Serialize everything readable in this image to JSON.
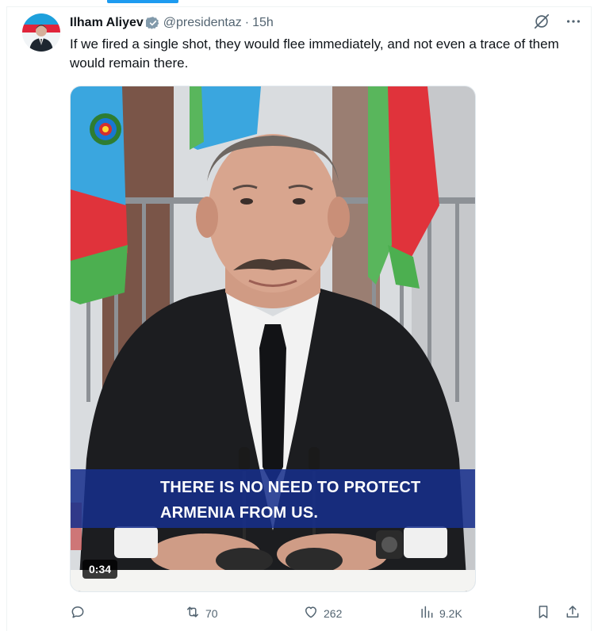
{
  "tweet": {
    "author_name": "Ilham Aliyev",
    "handle": "@presidentaz",
    "separator": "·",
    "time": "15h",
    "text": "If we fired a single shot, they would flee immediately, and not even a trace of them would remain there."
  },
  "media": {
    "caption_line1": "THERE IS NO NEED TO PROTECT",
    "caption_line2": "ARMENIA FROM US.",
    "duration": "0:34"
  },
  "actions": {
    "retweets": "70",
    "likes": "262",
    "views": "9.2K"
  },
  "colors": {
    "accent": "#1d9bf0",
    "secondary_text": "#536471",
    "caption_bg": "#162e8c"
  },
  "icons": [
    "verified-badge-icon",
    "grok-icon",
    "more-icon",
    "reply-icon",
    "retweet-icon",
    "like-icon",
    "views-icon",
    "bookmark-icon",
    "share-icon"
  ]
}
